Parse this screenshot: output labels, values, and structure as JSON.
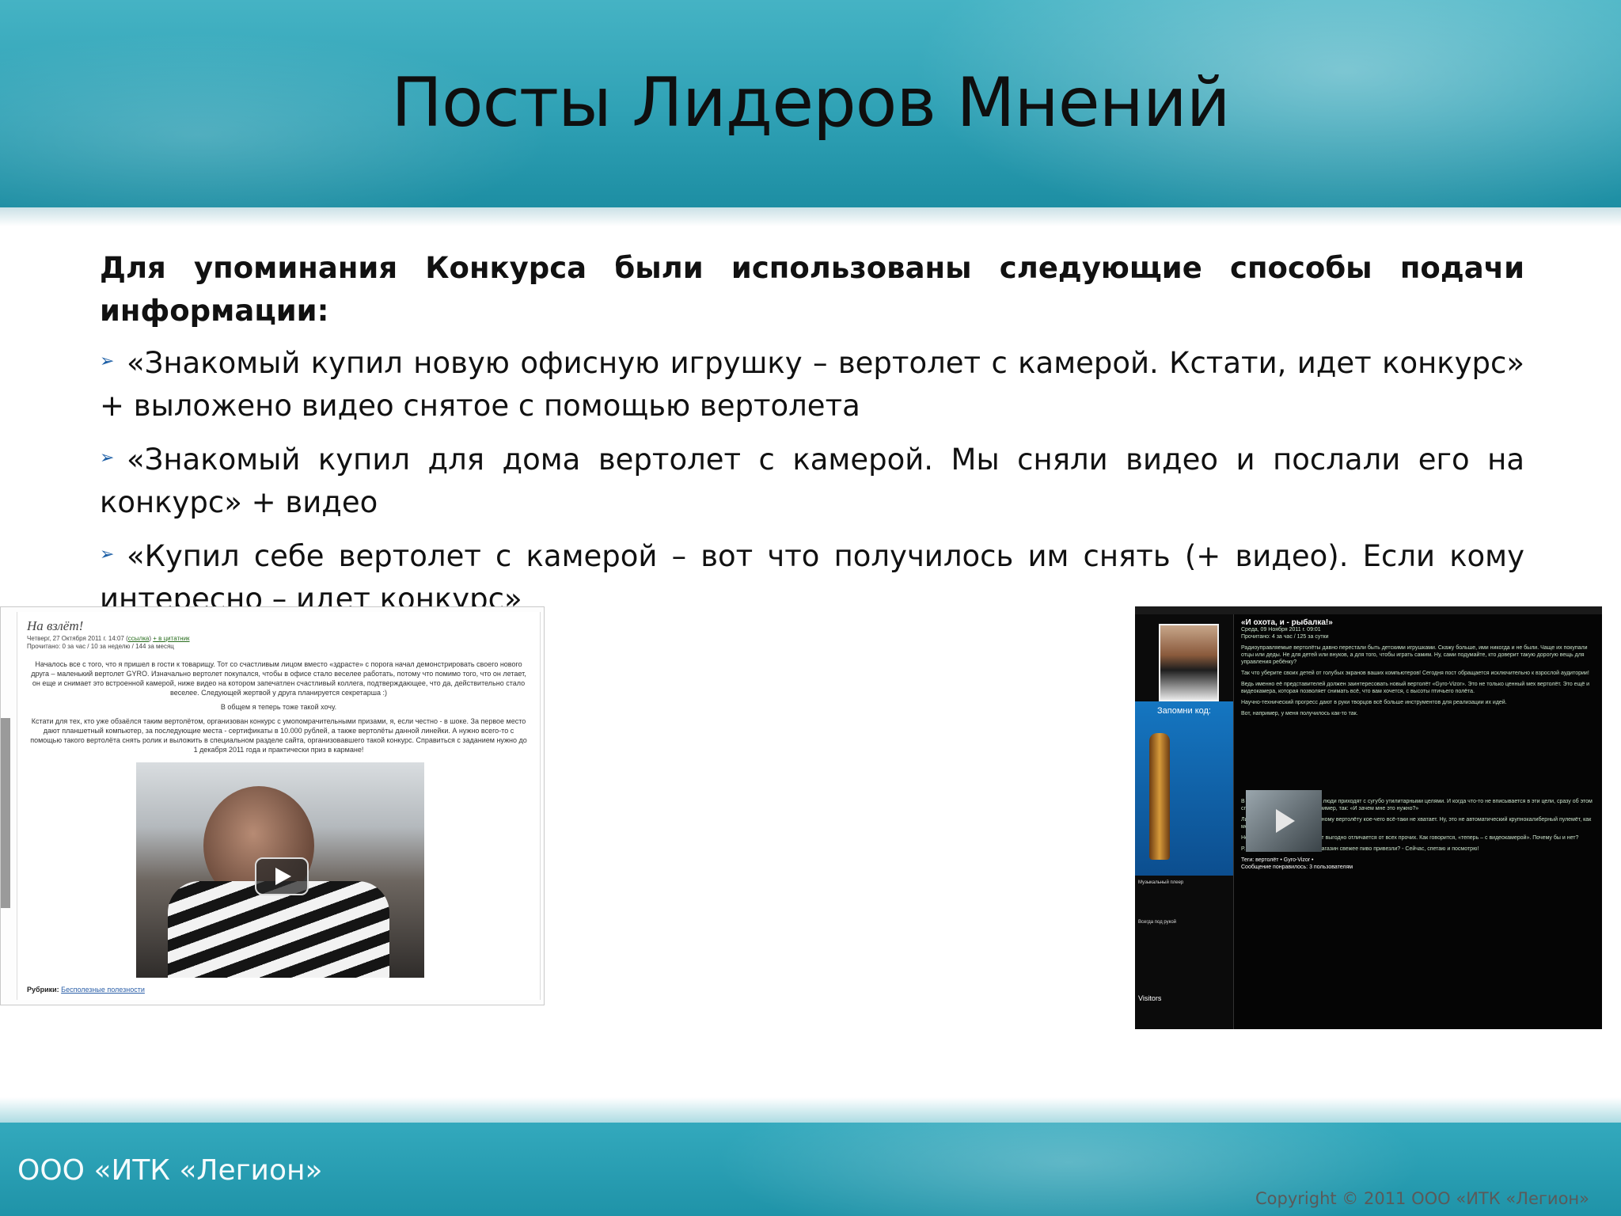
{
  "title": "Посты Лидеров Мнений",
  "intro": "Для упоминания Конкурса были использованы следующие способы подачи информации:",
  "bullets": [
    "«Знакомый купил новую офисную игрушку – вертолет с камерой. Кстати, идет конкурс» + выложено видео снятое с помощью вертолета",
    "«Знакомый купил для дома вертолет с камерой. Мы сняли видео и послали его на конкурс» + видео",
    "«Купил себе вертолет с камерой – вот что получилось им снять (+ видео). Если кому интересно – идет конкурс»"
  ],
  "left_post": {
    "title": "На взлёт!",
    "meta": "Четверг, 27 Октября 2011 г. 14:07 (",
    "meta_link": "ссылка",
    "meta_link2": "+ в цитатник",
    "stats": "Прочитано: 0 за час / 10 за неделю / 144 за месяц",
    "para1": "Началось все с того, что я пришел в гости к товарищу. Тот со счастливым лицом вместо «здрасте» с порога начал демонстрировать своего нового друга – маленький вертолет GYRO. Изначально вертолет покупался, чтобы в офисе стало веселее работать, потому что помимо того, что он летает, он еще и снимает это встроенной камерой, ниже видео на котором запечатлен счастливый коллега, подтверждающее, что да, действительно стало веселее. Следующей жертвой у друга планируется секретарша :)",
    "para2": "В общем я теперь тоже такой хочу.",
    "para3": "Кстати для тех, кто уже обзаёлся таким вертолётом, организован конкурс с умопомрачительными призами, я, если честно - в шоке. За первое место дают планшетный компьютер, за последующие места - сертификаты в 10.000 рублей, а также вертолёты данной линейки. А нужно всего-то с помощью такого вертолёта снять ролик и выложить в специальном разделе сайта, организовавшего такой конкурс. Справиться с заданием нужно до 1 декабря 2011 года и практически приз в кармане!",
    "rubric_label": "Рубрики:",
    "rubric_value": "Бесполезные полезности"
  },
  "right_post": {
    "ad_caption": "Запомни код:",
    "title": "«И охота, и - рыбалка!»",
    "meta": "Среда, 09 Ноября 2011 г. 09:01",
    "stats": "Прочитано: 4 за час / 125 за сутки",
    "para1": "Радиоуправляемые вертолёты давно перестали быть детскими игрушками. Скажу больше, ими никогда и не были. Чаще их покупали отцы или деды. Не для детей или внуков, а для того, чтобы играть самим. Ну, сами подумайте, кто доверит такую дорогую вещь для управления ребёнку?",
    "para2": "Так что уберите своих детей от голубых экранов ваших компьютеров! Сегодня пост обращается исключительно к взрослой аудитории!",
    "para3": "Ведь именно её представителей должен заинтересовать новый вертолёт «Gyro-Vizor». Это не только ценный мех вертолёт. Это ещё и видеокамера, которая позволяет снимать всё, что вам хочется, с высоты птичьего полёта.",
    "para4": "Научно-технический прогресс дают в руки творцов всё больше инструментов для реализации их идей.",
    "para5": "Вот, например, у меня получилось как-то так.",
    "para6": "В последнее время в Интернет люди приходят с сугубо утилитарными целями. И когда что-то не вписывается в эти цели, сразу об этом спрашивают. Как именно? Например, так: «И зачем мне это нужно?»",
    "para7": "Лично мне показалось, что данному вертолёту кое-чего всё-таки не хватает. Ну, это не автоматический крупнокалиберный пулемёт, как могли подумать некоторые.",
    "para8": "Но и в таком варианте вертолёт выгодно отличается от всех прочих. Как говорится, «теперь – с видеокамерой». Почему бы и нет?",
    "ps": "P.S. - Семёныч! Ну знаешь, в магазин свежее пиво привезли? - Сейчас, спетаю и посмотрю!",
    "tags": "Теги: вертолёт • Gyro-Vizor •",
    "liked": "Сообщение понравилось: 3 пользователям",
    "side_music": "Музыкальный плеер",
    "side_tour": "Всегда под рукой",
    "side_visitors": "Visitors"
  },
  "footer": {
    "company": "ООО «ИТК «Легион»",
    "copyright": "Copyright © 2011 ООО «ИТК «Легион»"
  }
}
